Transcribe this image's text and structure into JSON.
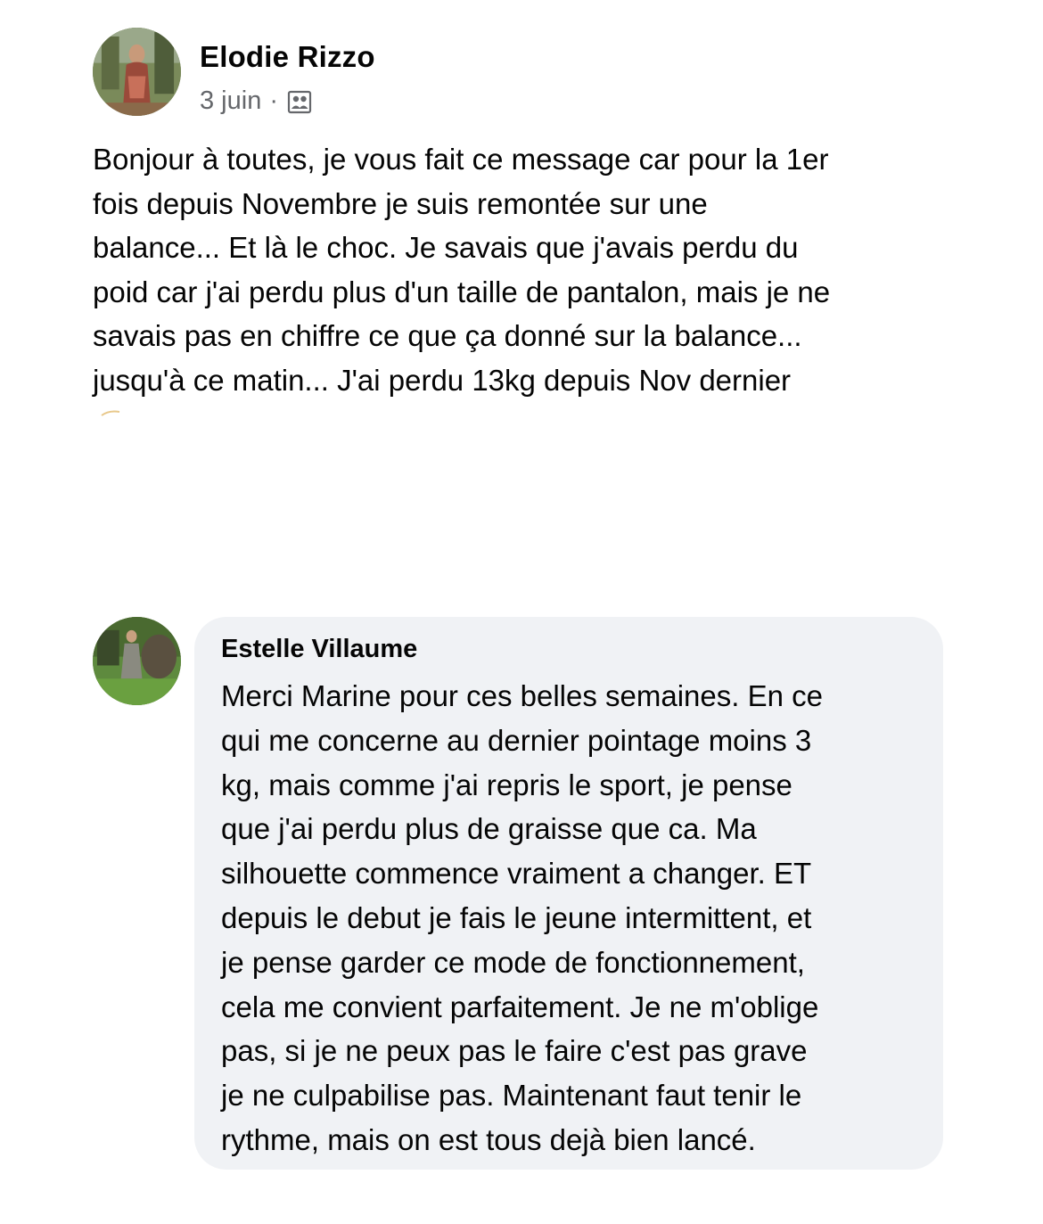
{
  "post": {
    "author": "Elodie Rizzo",
    "date": "3 juin",
    "separator": "·",
    "audience_icon": "group-audience-icon",
    "body": "Bonjour à toutes, je vous fait ce message car pour la 1er\nfois depuis Novembre je suis remontée sur une\nbalance... Et là le choc. Je savais que j'avais perdu du\npoid car j'ai perdu plus d'un taille de pantalon, mais je ne\nsavais pas en chiffre ce que ça donné sur la balance...\njusqu'à ce matin... J'ai perdu 13kg depuis Nov dernier"
  },
  "comment": {
    "author": "Estelle Villaume",
    "body": "Merci Marine pour ces belles semaines. En ce\nqui me concerne au dernier pointage moins 3\nkg, mais comme j'ai repris le sport, je pense\nque j'ai perdu plus de graisse que ca. Ma\nsilhouette commence vraiment a changer. ET\ndepuis le debut je fais le jeune intermittent, et\nje pense garder ce mode de fonctionnement,\ncela me convient parfaitement. Je ne m'oblige\npas, si je ne peux pas le faire c'est pas grave\nje ne culpabilise pas. Maintenant faut tenir le\nrythme, mais on est tous dejà bien lancé."
  },
  "colors": {
    "text": "#050505",
    "secondary_text": "#65676b",
    "bubble_bg": "#f0f2f5"
  }
}
